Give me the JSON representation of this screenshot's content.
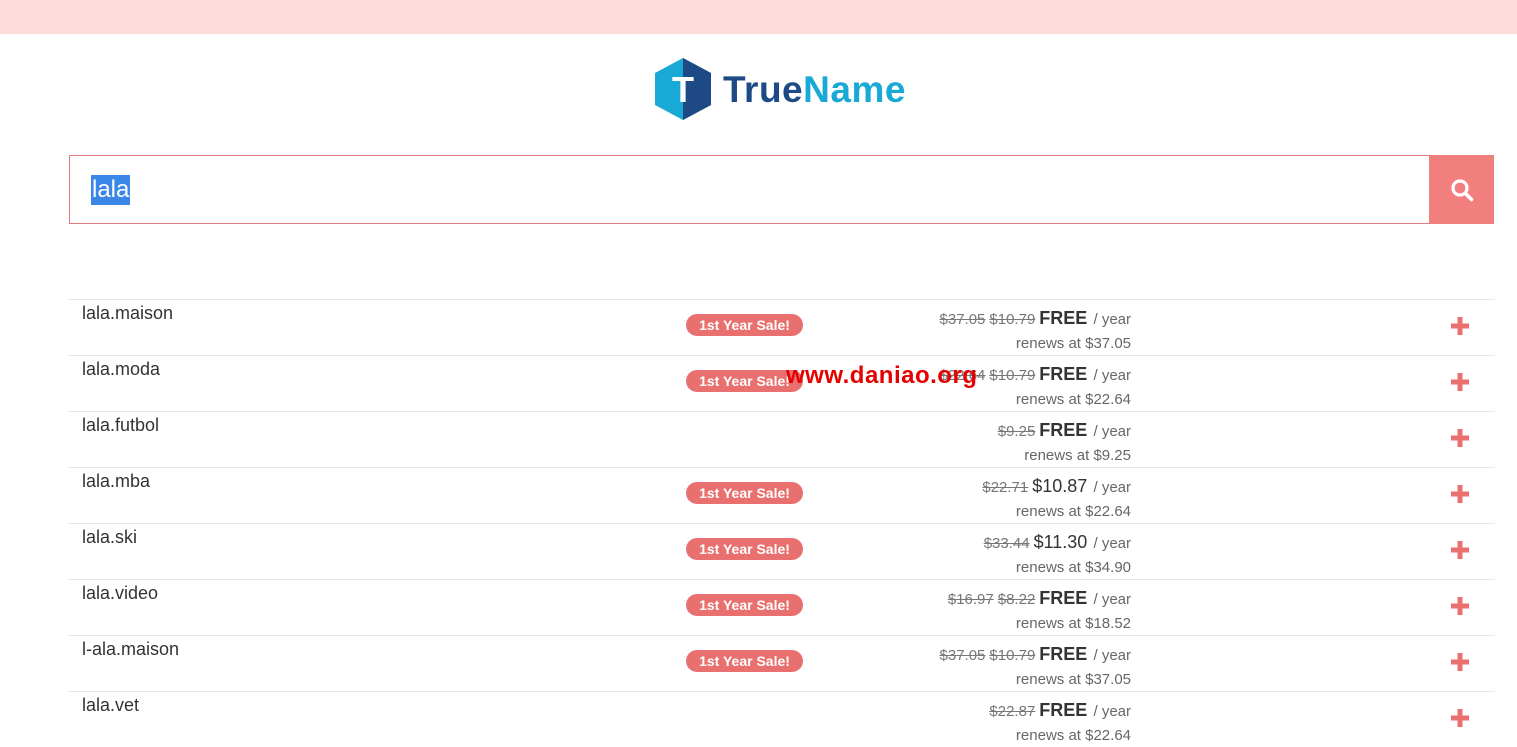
{
  "brand": {
    "logo_letter": "T",
    "name_part1": "True",
    "name_part2": "Name",
    "colors": {
      "dark": "#1d4a85",
      "light": "#18a9d6",
      "accent": "#f07f7d"
    }
  },
  "search": {
    "query": "lala",
    "button_icon": "search-icon"
  },
  "results": [
    {
      "domain": "lala.maison",
      "badge": "1st Year Sale!",
      "original": "$37.05",
      "sale": "$10.79",
      "price": "FREE",
      "unit": "/ year",
      "renews": "renews at $37.05"
    },
    {
      "domain": "lala.moda",
      "badge": "1st Year Sale!",
      "original": "$22.64",
      "sale": "$10.79",
      "price": "FREE",
      "unit": "/ year",
      "renews": "renews at $22.64"
    },
    {
      "domain": "lala.futbol",
      "badge": "",
      "original": "$9.25",
      "sale": "",
      "price": "FREE",
      "unit": "/ year",
      "renews": "renews at $9.25"
    },
    {
      "domain": "lala.mba",
      "badge": "1st Year Sale!",
      "original": "$22.71",
      "sale": "",
      "price": "$10.87",
      "unit": "/ year",
      "renews": "renews at $22.64"
    },
    {
      "domain": "lala.ski",
      "badge": "1st Year Sale!",
      "original": "$33.44",
      "sale": "",
      "price": "$11.30",
      "unit": "/ year",
      "renews": "renews at $34.90"
    },
    {
      "domain": "lala.video",
      "badge": "1st Year Sale!",
      "original": "$16.97",
      "sale": "$8.22",
      "price": "FREE",
      "unit": "/ year",
      "renews": "renews at $18.52"
    },
    {
      "domain": "l-ala.maison",
      "badge": "1st Year Sale!",
      "original": "$37.05",
      "sale": "$10.79",
      "price": "FREE",
      "unit": "/ year",
      "renews": "renews at $37.05"
    },
    {
      "domain": "lala.vet",
      "badge": "",
      "original": "$22.87",
      "sale": "",
      "price": "FREE",
      "unit": "/ year",
      "renews": "renews at $22.64"
    }
  ],
  "watermark": "www.daniao.org"
}
